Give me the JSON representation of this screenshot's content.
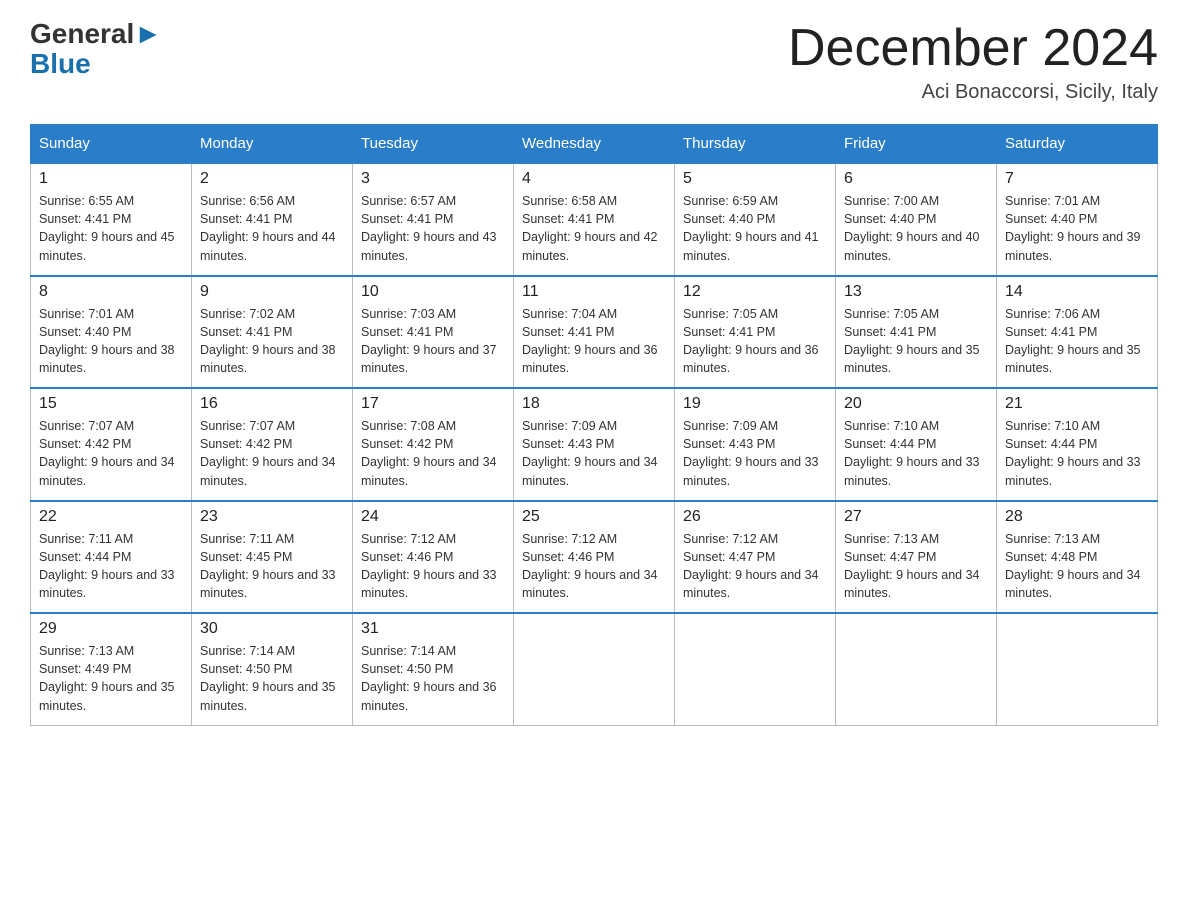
{
  "header": {
    "logo_general": "General",
    "logo_blue": "Blue",
    "month_title": "December 2024",
    "location": "Aci Bonaccorsi, Sicily, Italy"
  },
  "weekdays": [
    "Sunday",
    "Monday",
    "Tuesday",
    "Wednesday",
    "Thursday",
    "Friday",
    "Saturday"
  ],
  "weeks": [
    [
      {
        "day": "1",
        "sunrise": "6:55 AM",
        "sunset": "4:41 PM",
        "daylight": "9 hours and 45 minutes."
      },
      {
        "day": "2",
        "sunrise": "6:56 AM",
        "sunset": "4:41 PM",
        "daylight": "9 hours and 44 minutes."
      },
      {
        "day": "3",
        "sunrise": "6:57 AM",
        "sunset": "4:41 PM",
        "daylight": "9 hours and 43 minutes."
      },
      {
        "day": "4",
        "sunrise": "6:58 AM",
        "sunset": "4:41 PM",
        "daylight": "9 hours and 42 minutes."
      },
      {
        "day": "5",
        "sunrise": "6:59 AM",
        "sunset": "4:40 PM",
        "daylight": "9 hours and 41 minutes."
      },
      {
        "day": "6",
        "sunrise": "7:00 AM",
        "sunset": "4:40 PM",
        "daylight": "9 hours and 40 minutes."
      },
      {
        "day": "7",
        "sunrise": "7:01 AM",
        "sunset": "4:40 PM",
        "daylight": "9 hours and 39 minutes."
      }
    ],
    [
      {
        "day": "8",
        "sunrise": "7:01 AM",
        "sunset": "4:40 PM",
        "daylight": "9 hours and 38 minutes."
      },
      {
        "day": "9",
        "sunrise": "7:02 AM",
        "sunset": "4:41 PM",
        "daylight": "9 hours and 38 minutes."
      },
      {
        "day": "10",
        "sunrise": "7:03 AM",
        "sunset": "4:41 PM",
        "daylight": "9 hours and 37 minutes."
      },
      {
        "day": "11",
        "sunrise": "7:04 AM",
        "sunset": "4:41 PM",
        "daylight": "9 hours and 36 minutes."
      },
      {
        "day": "12",
        "sunrise": "7:05 AM",
        "sunset": "4:41 PM",
        "daylight": "9 hours and 36 minutes."
      },
      {
        "day": "13",
        "sunrise": "7:05 AM",
        "sunset": "4:41 PM",
        "daylight": "9 hours and 35 minutes."
      },
      {
        "day": "14",
        "sunrise": "7:06 AM",
        "sunset": "4:41 PM",
        "daylight": "9 hours and 35 minutes."
      }
    ],
    [
      {
        "day": "15",
        "sunrise": "7:07 AM",
        "sunset": "4:42 PM",
        "daylight": "9 hours and 34 minutes."
      },
      {
        "day": "16",
        "sunrise": "7:07 AM",
        "sunset": "4:42 PM",
        "daylight": "9 hours and 34 minutes."
      },
      {
        "day": "17",
        "sunrise": "7:08 AM",
        "sunset": "4:42 PM",
        "daylight": "9 hours and 34 minutes."
      },
      {
        "day": "18",
        "sunrise": "7:09 AM",
        "sunset": "4:43 PM",
        "daylight": "9 hours and 34 minutes."
      },
      {
        "day": "19",
        "sunrise": "7:09 AM",
        "sunset": "4:43 PM",
        "daylight": "9 hours and 33 minutes."
      },
      {
        "day": "20",
        "sunrise": "7:10 AM",
        "sunset": "4:44 PM",
        "daylight": "9 hours and 33 minutes."
      },
      {
        "day": "21",
        "sunrise": "7:10 AM",
        "sunset": "4:44 PM",
        "daylight": "9 hours and 33 minutes."
      }
    ],
    [
      {
        "day": "22",
        "sunrise": "7:11 AM",
        "sunset": "4:44 PM",
        "daylight": "9 hours and 33 minutes."
      },
      {
        "day": "23",
        "sunrise": "7:11 AM",
        "sunset": "4:45 PM",
        "daylight": "9 hours and 33 minutes."
      },
      {
        "day": "24",
        "sunrise": "7:12 AM",
        "sunset": "4:46 PM",
        "daylight": "9 hours and 33 minutes."
      },
      {
        "day": "25",
        "sunrise": "7:12 AM",
        "sunset": "4:46 PM",
        "daylight": "9 hours and 34 minutes."
      },
      {
        "day": "26",
        "sunrise": "7:12 AM",
        "sunset": "4:47 PM",
        "daylight": "9 hours and 34 minutes."
      },
      {
        "day": "27",
        "sunrise": "7:13 AM",
        "sunset": "4:47 PM",
        "daylight": "9 hours and 34 minutes."
      },
      {
        "day": "28",
        "sunrise": "7:13 AM",
        "sunset": "4:48 PM",
        "daylight": "9 hours and 34 minutes."
      }
    ],
    [
      {
        "day": "29",
        "sunrise": "7:13 AM",
        "sunset": "4:49 PM",
        "daylight": "9 hours and 35 minutes."
      },
      {
        "day": "30",
        "sunrise": "7:14 AM",
        "sunset": "4:50 PM",
        "daylight": "9 hours and 35 minutes."
      },
      {
        "day": "31",
        "sunrise": "7:14 AM",
        "sunset": "4:50 PM",
        "daylight": "9 hours and 36 minutes."
      },
      null,
      null,
      null,
      null
    ]
  ]
}
